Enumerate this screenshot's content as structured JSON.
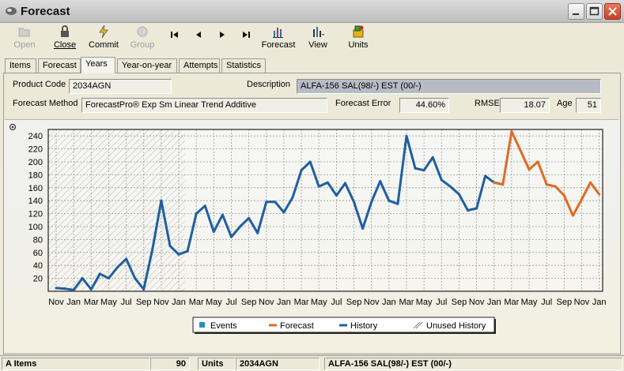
{
  "window": {
    "title": "Forecast"
  },
  "toolbar": {
    "open": "Open",
    "close": "Close",
    "commit": "Commit",
    "group": "Group",
    "forecast": "Forecast",
    "view": "View",
    "units": "Units"
  },
  "tabs": [
    "Items",
    "Forecast",
    "Years",
    "Year-on-year",
    "Attempts",
    "Statistics"
  ],
  "active_tab": "Years",
  "fields": {
    "product_code_label": "Product Code",
    "product_code": "2034AGN",
    "description_label": "Description",
    "description": "ALFA-156 SAL(98/-) EST (00/-)",
    "forecast_method_label": "Forecast Method",
    "forecast_method": "ForecastPro® Exp Sm Linear Trend Additive",
    "forecast_error_label": "Forecast Error",
    "forecast_error": "44.60%",
    "rmse_label": "RMSE",
    "rmse": "18.07",
    "age_label": "Age",
    "age": "51"
  },
  "chart_data": {
    "type": "line",
    "ylim": [
      0,
      250
    ],
    "yticks": [
      20,
      40,
      60,
      80,
      100,
      120,
      140,
      160,
      180,
      200,
      220,
      240
    ],
    "xtick_labels": [
      "Nov",
      "Jan",
      "Mar",
      "May",
      "Jul",
      "Sep",
      "Nov",
      "Jan",
      "Mar",
      "May",
      "Jul",
      "Sep",
      "Nov",
      "Jan",
      "Mar",
      "May",
      "Jul",
      "Sep",
      "Nov",
      "Jan",
      "Mar",
      "May",
      "Jul",
      "Sep",
      "Nov",
      "Jan",
      "Mar",
      "May",
      "Jul",
      "Sep",
      "Nov",
      "Jan"
    ],
    "unused_history_months": 15,
    "series": [
      {
        "name": "History",
        "color": "#1f5fa0",
        "start_month": 0,
        "values": [
          5,
          4,
          2,
          20,
          3,
          27,
          20,
          37,
          50,
          20,
          3,
          65,
          140,
          70,
          57,
          62,
          120,
          132,
          92,
          118,
          84,
          100,
          113,
          90,
          138,
          138,
          122,
          145,
          187,
          200,
          162,
          168,
          148,
          167,
          138,
          97,
          138,
          170,
          140,
          135,
          240,
          190,
          187,
          207,
          172,
          162,
          150,
          125,
          128,
          178,
          168,
          165
        ]
      },
      {
        "name": "Forecast",
        "color": "#e06a25",
        "start_month": 50,
        "values": [
          168,
          165,
          247,
          218,
          188,
          200,
          165,
          162,
          148,
          117,
          142,
          168,
          150
        ]
      }
    ],
    "legend": [
      "Events",
      "Forecast",
      "History",
      "Unused History"
    ],
    "legend_colors": {
      "Events": "#2a8fc0",
      "Forecast": "#e06a25",
      "History": "#1f5fa0",
      "Unused History": "#808080"
    },
    "grid": true,
    "legend_position": "bottom"
  },
  "status": {
    "items_label": "A Items",
    "count": "90",
    "units": "Units",
    "code": "2034AGN",
    "description": "ALFA-156 SAL(98/-) EST (00/-)"
  }
}
